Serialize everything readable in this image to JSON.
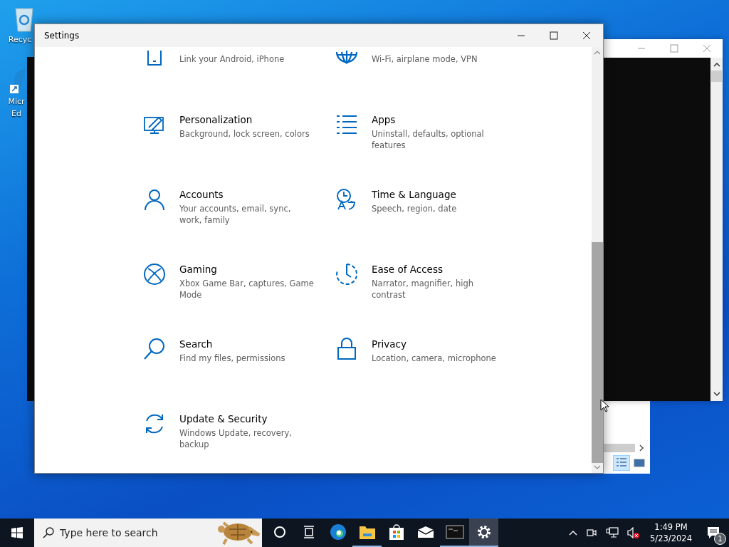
{
  "desktop": {
    "icons": [
      {
        "kind": "recycle",
        "lines": [
          "Recyc"
        ]
      },
      {
        "kind": "edge",
        "lines": [
          "Micr",
          "Ed"
        ]
      }
    ]
  },
  "settings_window": {
    "title": "Settings",
    "items": [
      {
        "kind": "phone",
        "description": "Link your Android, iPhone"
      },
      {
        "kind": "globe",
        "description": "Wi-Fi, airplane mode, VPN"
      },
      {
        "kind": "personalization",
        "title": "Personalization",
        "description": "Background, lock screen, colors"
      },
      {
        "kind": "apps",
        "title": "Apps",
        "description": "Uninstall, defaults, optional features"
      },
      {
        "kind": "accounts",
        "title": "Accounts",
        "description": "Your accounts, email, sync, work, family"
      },
      {
        "kind": "time",
        "title": "Time & Language",
        "description": "Speech, region, date"
      },
      {
        "kind": "gaming",
        "title": "Gaming",
        "description": "Xbox Game Bar, captures, Game Mode"
      },
      {
        "kind": "ease",
        "title": "Ease of Access",
        "description": "Narrator, magnifier, high contrast"
      },
      {
        "kind": "search",
        "title": "Search",
        "description": "Find my files, permissions"
      },
      {
        "kind": "privacy",
        "title": "Privacy",
        "description": "Location, camera, microphone"
      },
      {
        "kind": "update",
        "title": "Update & Security",
        "description": "Windows Update, recovery, backup"
      }
    ]
  },
  "taskbar": {
    "search": {
      "placeholder": "Type here to search"
    },
    "apps": [
      {
        "kind": "cortana",
        "running": false,
        "selected": false
      },
      {
        "kind": "taskview",
        "running": false,
        "selected": false
      },
      {
        "kind": "edge",
        "running": false,
        "selected": false
      },
      {
        "kind": "explorer",
        "running": true,
        "selected": false
      },
      {
        "kind": "store",
        "running": false,
        "selected": false
      },
      {
        "kind": "mail",
        "running": false,
        "selected": false
      },
      {
        "kind": "terminal",
        "running": true,
        "selected": false
      },
      {
        "kind": "settings",
        "running": true,
        "selected": true
      }
    ],
    "time": "1:49 PM",
    "date": "5/23/2024",
    "notification_count": "1"
  }
}
